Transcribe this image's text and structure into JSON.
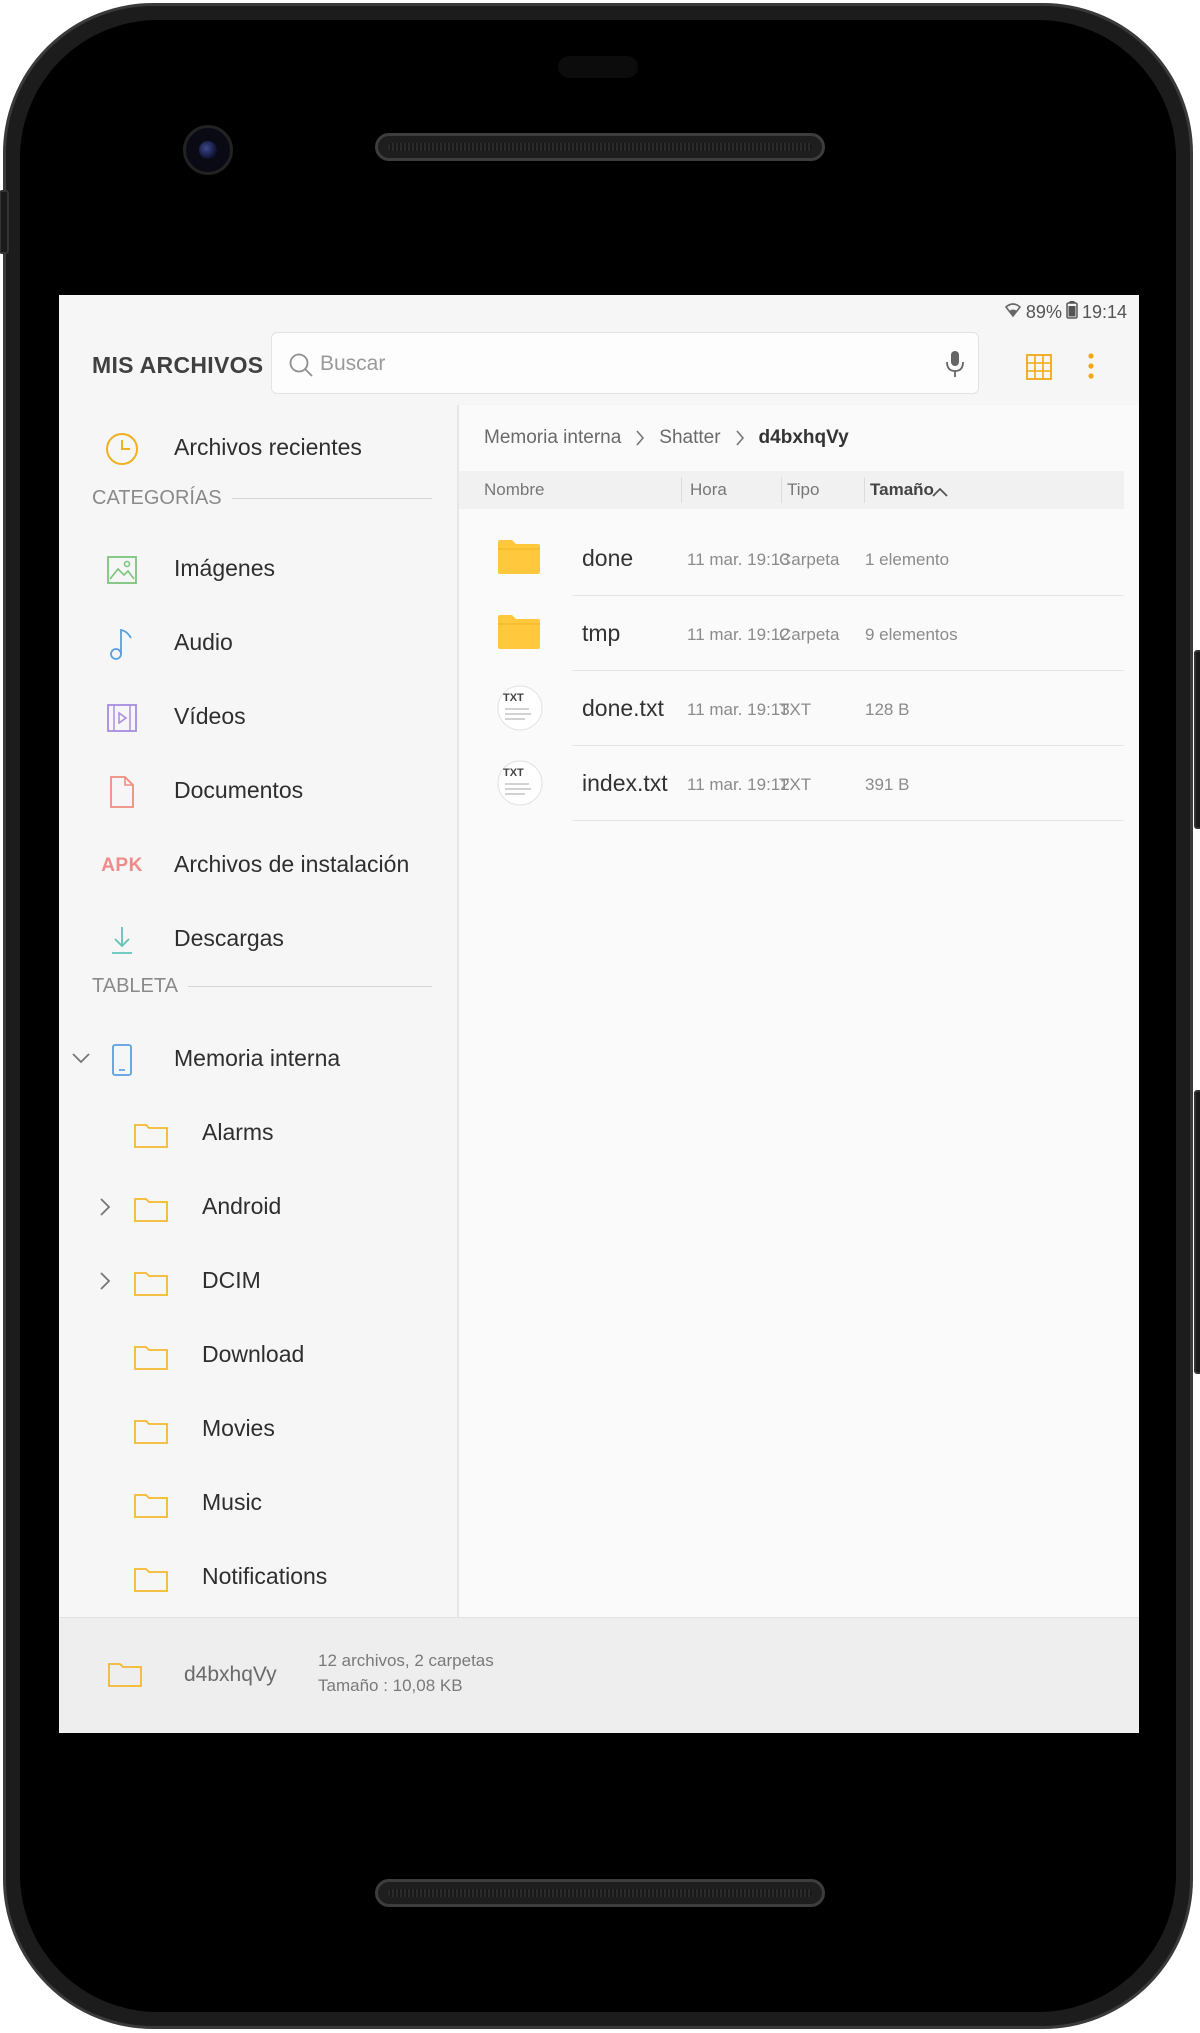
{
  "status": {
    "battery": "89%",
    "time": "19:14"
  },
  "app": {
    "title": "MIS ARCHIVOS",
    "search_placeholder": "Buscar"
  },
  "sidebar": {
    "recent": "Archivos recientes",
    "categories_title": "CATEGORÍAS",
    "categories": [
      {
        "label": "Imágenes",
        "icon": "image-icon"
      },
      {
        "label": "Audio",
        "icon": "music-note-icon"
      },
      {
        "label": "Vídeos",
        "icon": "video-icon"
      },
      {
        "label": "Documentos",
        "icon": "document-icon"
      },
      {
        "label": "Archivos de instalación",
        "icon": "apk-icon",
        "badge": "APK"
      },
      {
        "label": "Descargas",
        "icon": "download-icon"
      }
    ],
    "device_title": "TABLETA",
    "storage": "Memoria interna",
    "folders": [
      {
        "label": "Alarms",
        "expandable": false
      },
      {
        "label": "Android",
        "expandable": true
      },
      {
        "label": "DCIM",
        "expandable": true
      },
      {
        "label": "Download",
        "expandable": false
      },
      {
        "label": "Movies",
        "expandable": false
      },
      {
        "label": "Music",
        "expandable": false
      },
      {
        "label": "Notifications",
        "expandable": false
      }
    ]
  },
  "breadcrumb": [
    "Memoria interna",
    "Shatter",
    "d4bxhqVy"
  ],
  "columns": {
    "name": "Nombre",
    "time": "Hora",
    "type": "Tipo",
    "size": "Tamaño"
  },
  "files": [
    {
      "name": "done",
      "time": "11 mar. 19:13",
      "type": "Carpeta",
      "size": "1 elemento",
      "kind": "folder"
    },
    {
      "name": "tmp",
      "time": "11 mar. 19:12",
      "type": "Carpeta",
      "size": "9 elementos",
      "kind": "folder"
    },
    {
      "name": "done.txt",
      "time": "11 mar. 19:13",
      "type": "TXT",
      "size": "128 B",
      "kind": "txt"
    },
    {
      "name": "index.txt",
      "time": "11 mar. 19:12",
      "type": "TXT",
      "size": "391 B",
      "kind": "txt"
    }
  ],
  "txt_badge": "TXT",
  "bottom": {
    "folder_name": "d4bxhqVy",
    "info_line1": "12 archivos, 2 carpetas",
    "info_line2": "Tamaño : 10,08 KB"
  },
  "colors": {
    "accent": "#f0a818",
    "folder": "#ffc83d"
  }
}
